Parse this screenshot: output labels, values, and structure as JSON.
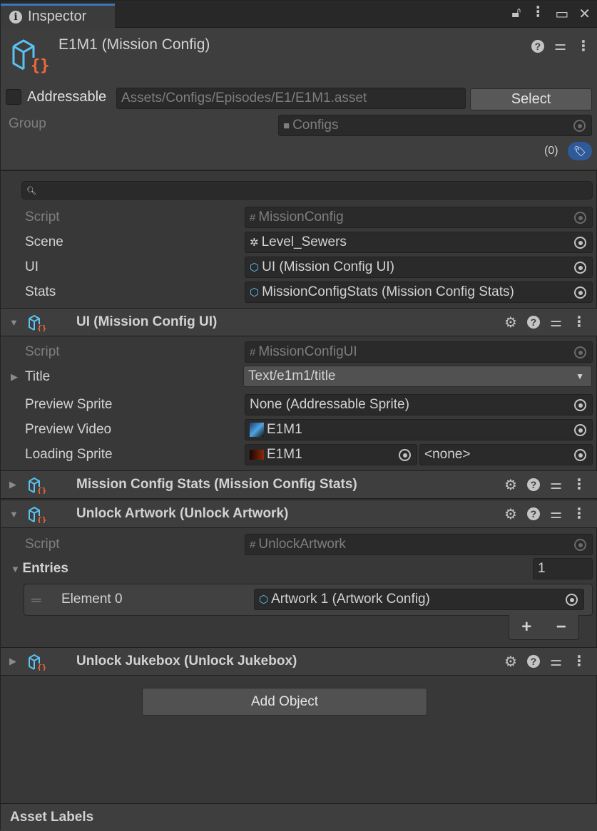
{
  "window": {
    "tab_title": "Inspector",
    "tab_icon": "info-icon"
  },
  "header": {
    "title": "E1M1 (Mission Config)",
    "addressable_label": "Addressable",
    "addressable_checked": false,
    "path": "Assets/Configs/Episodes/E1/E1M1.asset",
    "select_label": "Select",
    "group_label": "Group",
    "group_value": "Configs",
    "labels_count": "(0)"
  },
  "search": {
    "placeholder": ""
  },
  "fields": [
    {
      "label": "Script",
      "value": "MissionConfig",
      "icon": "script-icon",
      "disabled": true
    },
    {
      "label": "Scene",
      "value": "Level_Sewers",
      "icon": "unity-scene-icon"
    },
    {
      "label": "UI",
      "value": "UI (Mission Config UI)",
      "icon": "scriptable-object-icon"
    },
    {
      "label": "Stats",
      "value": "MissionConfigStats (Mission Config Stats)",
      "icon": "scriptable-object-icon"
    }
  ],
  "components": [
    {
      "title": "UI (Mission Config UI)",
      "expanded": true,
      "fields": [
        {
          "label": "Script",
          "value": "MissionConfigUI",
          "disabled": true
        },
        {
          "label": "Title",
          "value": "Text/e1m1/title"
        },
        {
          "label": "Preview Sprite",
          "value": "None (Addressable Sprite)"
        },
        {
          "label": "Preview Video",
          "value": "E1M1"
        },
        {
          "label": "Loading Sprite",
          "value": "E1M1",
          "value2": "<none>"
        }
      ]
    },
    {
      "title": "Mission Config Stats (Mission Config Stats)",
      "expanded": false
    },
    {
      "title": "Unlock Artwork (Unlock Artwork)",
      "expanded": true,
      "fields": [
        {
          "label": "Script",
          "value": "UnlockArtwork",
          "disabled": true
        },
        {
          "label": "Entries",
          "value": "1"
        }
      ],
      "elements": [
        {
          "label": "Element 0",
          "value": "Artwork 1 (Artwork Config)"
        }
      ],
      "add": "+",
      "remove": "−"
    },
    {
      "title": "Unlock Jukebox (Unlock Jukebox)",
      "expanded": false
    }
  ],
  "add_object_label": "Add Object",
  "asset_labels": "Asset Labels",
  "colors": {
    "accent": "#3a79bb",
    "tag_badge": "#2f5a9a",
    "cube_icon": "#5bc2f2",
    "braces_icon": "#f26a3a"
  }
}
